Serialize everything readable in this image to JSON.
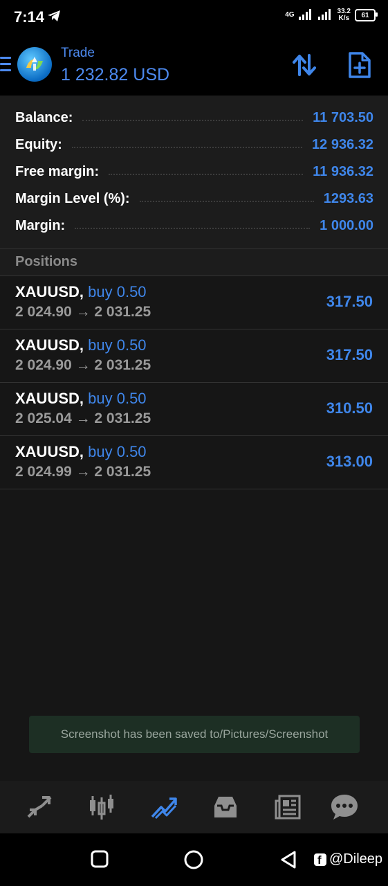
{
  "status_bar": {
    "time": "7:14",
    "network_label": "4G",
    "speed_value": "33.2",
    "speed_unit": "K/s",
    "battery": "61"
  },
  "header": {
    "title": "Trade",
    "subtitle": "1 232.82 USD"
  },
  "account": [
    {
      "label": "Balance:",
      "value": "11 703.50"
    },
    {
      "label": "Equity:",
      "value": "12 936.32"
    },
    {
      "label": "Free margin:",
      "value": "11 936.32"
    },
    {
      "label": "Margin Level (%):",
      "value": "1293.63"
    },
    {
      "label": "Margin:",
      "value": "1 000.00"
    }
  ],
  "positions": {
    "header": "Positions",
    "items": [
      {
        "symbol": "XAUUSD,",
        "type": "buy 0.50",
        "prices": "2 024.90 → 2 031.25",
        "profit": "317.50"
      },
      {
        "symbol": "XAUUSD,",
        "type": "buy 0.50",
        "prices": "2 024.90 → 2 031.25",
        "profit": "317.50"
      },
      {
        "symbol": "XAUUSD,",
        "type": "buy 0.50",
        "prices": "2 025.04 → 2 031.25",
        "profit": "310.50"
      },
      {
        "symbol": "XAUUSD,",
        "type": "buy 0.50",
        "prices": "2 024.99 → 2 031.25",
        "profit": "313.00"
      }
    ]
  },
  "toast": "Screenshot has been saved to/Pictures/Screenshot",
  "tabs": [
    {
      "icon": "quotes-icon",
      "active": false
    },
    {
      "icon": "chart-icon",
      "active": false
    },
    {
      "icon": "trade-icon",
      "active": true
    },
    {
      "icon": "history-icon",
      "active": false
    },
    {
      "icon": "news-icon",
      "active": false
    },
    {
      "icon": "messages-icon",
      "active": false
    }
  ],
  "watermark": "@Dileep",
  "colors": {
    "accent": "#3f86ea",
    "background": "#161616",
    "panel": "#1c1c1c",
    "toast": "#1d2f24"
  }
}
